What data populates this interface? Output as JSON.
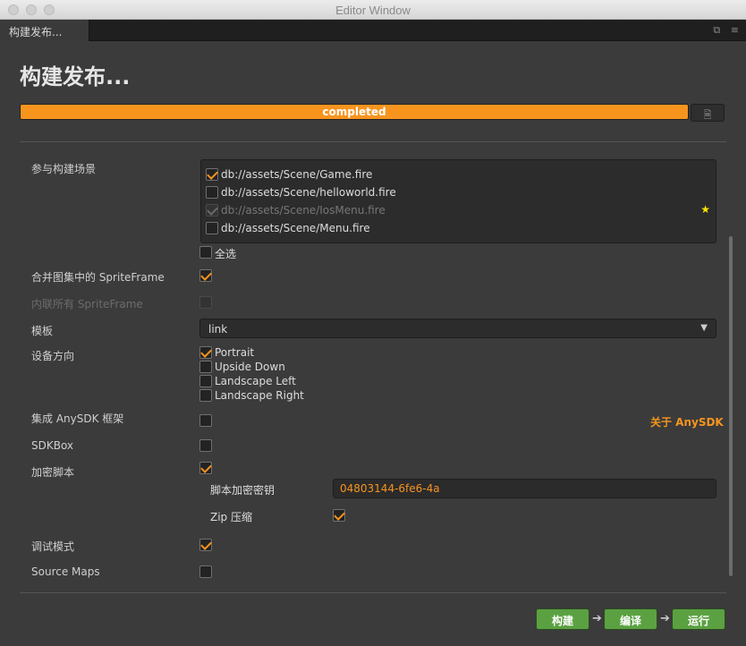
{
  "window": {
    "title": "Editor Window"
  },
  "tab": {
    "label": "构建发布..."
  },
  "page": {
    "title": "构建发布..."
  },
  "progress": {
    "value": 1.0,
    "label": "completed",
    "color": "#f7941e"
  },
  "scenes": {
    "label": "参与构建场景",
    "items": [
      {
        "path": "db://assets/Scene/Game.fire",
        "checked": true,
        "disabled": false
      },
      {
        "path": "db://assets/Scene/helloworld.fire",
        "checked": false,
        "disabled": false
      },
      {
        "path": "db://assets/Scene/IosMenu.fire",
        "checked": true,
        "disabled": true,
        "start_scene": true
      },
      {
        "path": "db://assets/Scene/Menu.fire",
        "checked": false,
        "disabled": false
      }
    ],
    "select_all_label": "全选"
  },
  "merge_sprite": {
    "label": "合并图集中的 SpriteFrame",
    "checked": true
  },
  "inline_sprite": {
    "label": "内联所有 SpriteFrame",
    "checked": false,
    "disabled": true
  },
  "template": {
    "label": "模板",
    "value": "link"
  },
  "orientation": {
    "label": "设备方向",
    "options": [
      {
        "label": "Portrait",
        "checked": true
      },
      {
        "label": "Upside Down",
        "checked": false
      },
      {
        "label": "Landscape Left",
        "checked": false
      },
      {
        "label": "Landscape Right",
        "checked": false
      }
    ]
  },
  "anysdk": {
    "label": "集成 AnySDK 框架",
    "checked": false,
    "link": "关于 AnySDK"
  },
  "sdkbox": {
    "label": "SDKBox",
    "checked": false
  },
  "encrypt": {
    "label": "加密脚本",
    "checked": true,
    "key_label": "脚本加密密钥",
    "key_value": "04803144-6fe6-4a",
    "zip_label": "Zip 压缩",
    "zip_checked": true
  },
  "debug": {
    "label": "调试模式",
    "checked": true
  },
  "sourcemaps": {
    "label": "Source Maps",
    "checked": false
  },
  "actions": {
    "build": "构建",
    "compile": "编译",
    "run": "运行"
  },
  "colors": {
    "accent": "#f7941e",
    "button_green": "#5ba142",
    "star": "#f5e600"
  }
}
